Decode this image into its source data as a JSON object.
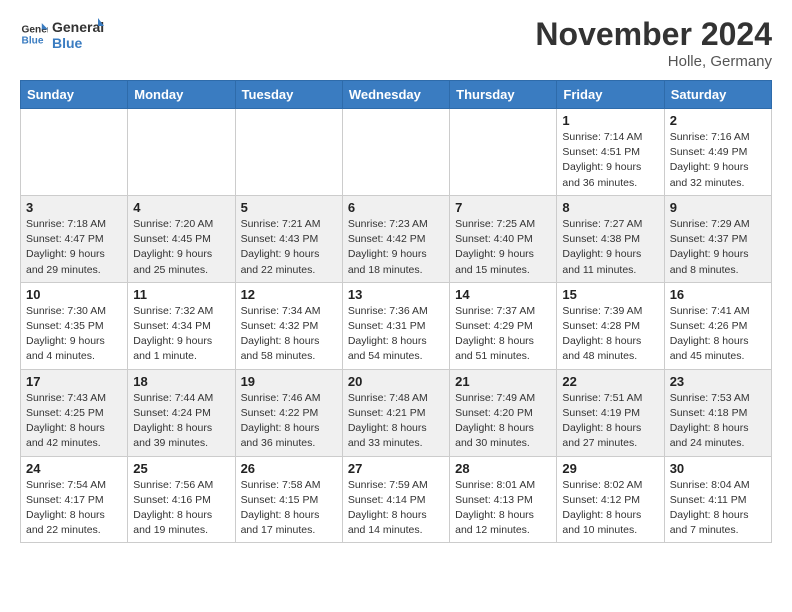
{
  "logo": {
    "line1": "General",
    "line2": "Blue"
  },
  "title": "November 2024",
  "location": "Holle, Germany",
  "weekdays": [
    "Sunday",
    "Monday",
    "Tuesday",
    "Wednesday",
    "Thursday",
    "Friday",
    "Saturday"
  ],
  "weeks": [
    [
      {
        "day": "",
        "info": ""
      },
      {
        "day": "",
        "info": ""
      },
      {
        "day": "",
        "info": ""
      },
      {
        "day": "",
        "info": ""
      },
      {
        "day": "",
        "info": ""
      },
      {
        "day": "1",
        "info": "Sunrise: 7:14 AM\nSunset: 4:51 PM\nDaylight: 9 hours\nand 36 minutes."
      },
      {
        "day": "2",
        "info": "Sunrise: 7:16 AM\nSunset: 4:49 PM\nDaylight: 9 hours\nand 32 minutes."
      }
    ],
    [
      {
        "day": "3",
        "info": "Sunrise: 7:18 AM\nSunset: 4:47 PM\nDaylight: 9 hours\nand 29 minutes."
      },
      {
        "day": "4",
        "info": "Sunrise: 7:20 AM\nSunset: 4:45 PM\nDaylight: 9 hours\nand 25 minutes."
      },
      {
        "day": "5",
        "info": "Sunrise: 7:21 AM\nSunset: 4:43 PM\nDaylight: 9 hours\nand 22 minutes."
      },
      {
        "day": "6",
        "info": "Sunrise: 7:23 AM\nSunset: 4:42 PM\nDaylight: 9 hours\nand 18 minutes."
      },
      {
        "day": "7",
        "info": "Sunrise: 7:25 AM\nSunset: 4:40 PM\nDaylight: 9 hours\nand 15 minutes."
      },
      {
        "day": "8",
        "info": "Sunrise: 7:27 AM\nSunset: 4:38 PM\nDaylight: 9 hours\nand 11 minutes."
      },
      {
        "day": "9",
        "info": "Sunrise: 7:29 AM\nSunset: 4:37 PM\nDaylight: 9 hours\nand 8 minutes."
      }
    ],
    [
      {
        "day": "10",
        "info": "Sunrise: 7:30 AM\nSunset: 4:35 PM\nDaylight: 9 hours\nand 4 minutes."
      },
      {
        "day": "11",
        "info": "Sunrise: 7:32 AM\nSunset: 4:34 PM\nDaylight: 9 hours\nand 1 minute."
      },
      {
        "day": "12",
        "info": "Sunrise: 7:34 AM\nSunset: 4:32 PM\nDaylight: 8 hours\nand 58 minutes."
      },
      {
        "day": "13",
        "info": "Sunrise: 7:36 AM\nSunset: 4:31 PM\nDaylight: 8 hours\nand 54 minutes."
      },
      {
        "day": "14",
        "info": "Sunrise: 7:37 AM\nSunset: 4:29 PM\nDaylight: 8 hours\nand 51 minutes."
      },
      {
        "day": "15",
        "info": "Sunrise: 7:39 AM\nSunset: 4:28 PM\nDaylight: 8 hours\nand 48 minutes."
      },
      {
        "day": "16",
        "info": "Sunrise: 7:41 AM\nSunset: 4:26 PM\nDaylight: 8 hours\nand 45 minutes."
      }
    ],
    [
      {
        "day": "17",
        "info": "Sunrise: 7:43 AM\nSunset: 4:25 PM\nDaylight: 8 hours\nand 42 minutes."
      },
      {
        "day": "18",
        "info": "Sunrise: 7:44 AM\nSunset: 4:24 PM\nDaylight: 8 hours\nand 39 minutes."
      },
      {
        "day": "19",
        "info": "Sunrise: 7:46 AM\nSunset: 4:22 PM\nDaylight: 8 hours\nand 36 minutes."
      },
      {
        "day": "20",
        "info": "Sunrise: 7:48 AM\nSunset: 4:21 PM\nDaylight: 8 hours\nand 33 minutes."
      },
      {
        "day": "21",
        "info": "Sunrise: 7:49 AM\nSunset: 4:20 PM\nDaylight: 8 hours\nand 30 minutes."
      },
      {
        "day": "22",
        "info": "Sunrise: 7:51 AM\nSunset: 4:19 PM\nDaylight: 8 hours\nand 27 minutes."
      },
      {
        "day": "23",
        "info": "Sunrise: 7:53 AM\nSunset: 4:18 PM\nDaylight: 8 hours\nand 24 minutes."
      }
    ],
    [
      {
        "day": "24",
        "info": "Sunrise: 7:54 AM\nSunset: 4:17 PM\nDaylight: 8 hours\nand 22 minutes."
      },
      {
        "day": "25",
        "info": "Sunrise: 7:56 AM\nSunset: 4:16 PM\nDaylight: 8 hours\nand 19 minutes."
      },
      {
        "day": "26",
        "info": "Sunrise: 7:58 AM\nSunset: 4:15 PM\nDaylight: 8 hours\nand 17 minutes."
      },
      {
        "day": "27",
        "info": "Sunrise: 7:59 AM\nSunset: 4:14 PM\nDaylight: 8 hours\nand 14 minutes."
      },
      {
        "day": "28",
        "info": "Sunrise: 8:01 AM\nSunset: 4:13 PM\nDaylight: 8 hours\nand 12 minutes."
      },
      {
        "day": "29",
        "info": "Sunrise: 8:02 AM\nSunset: 4:12 PM\nDaylight: 8 hours\nand 10 minutes."
      },
      {
        "day": "30",
        "info": "Sunrise: 8:04 AM\nSunset: 4:11 PM\nDaylight: 8 hours\nand 7 minutes."
      }
    ]
  ]
}
